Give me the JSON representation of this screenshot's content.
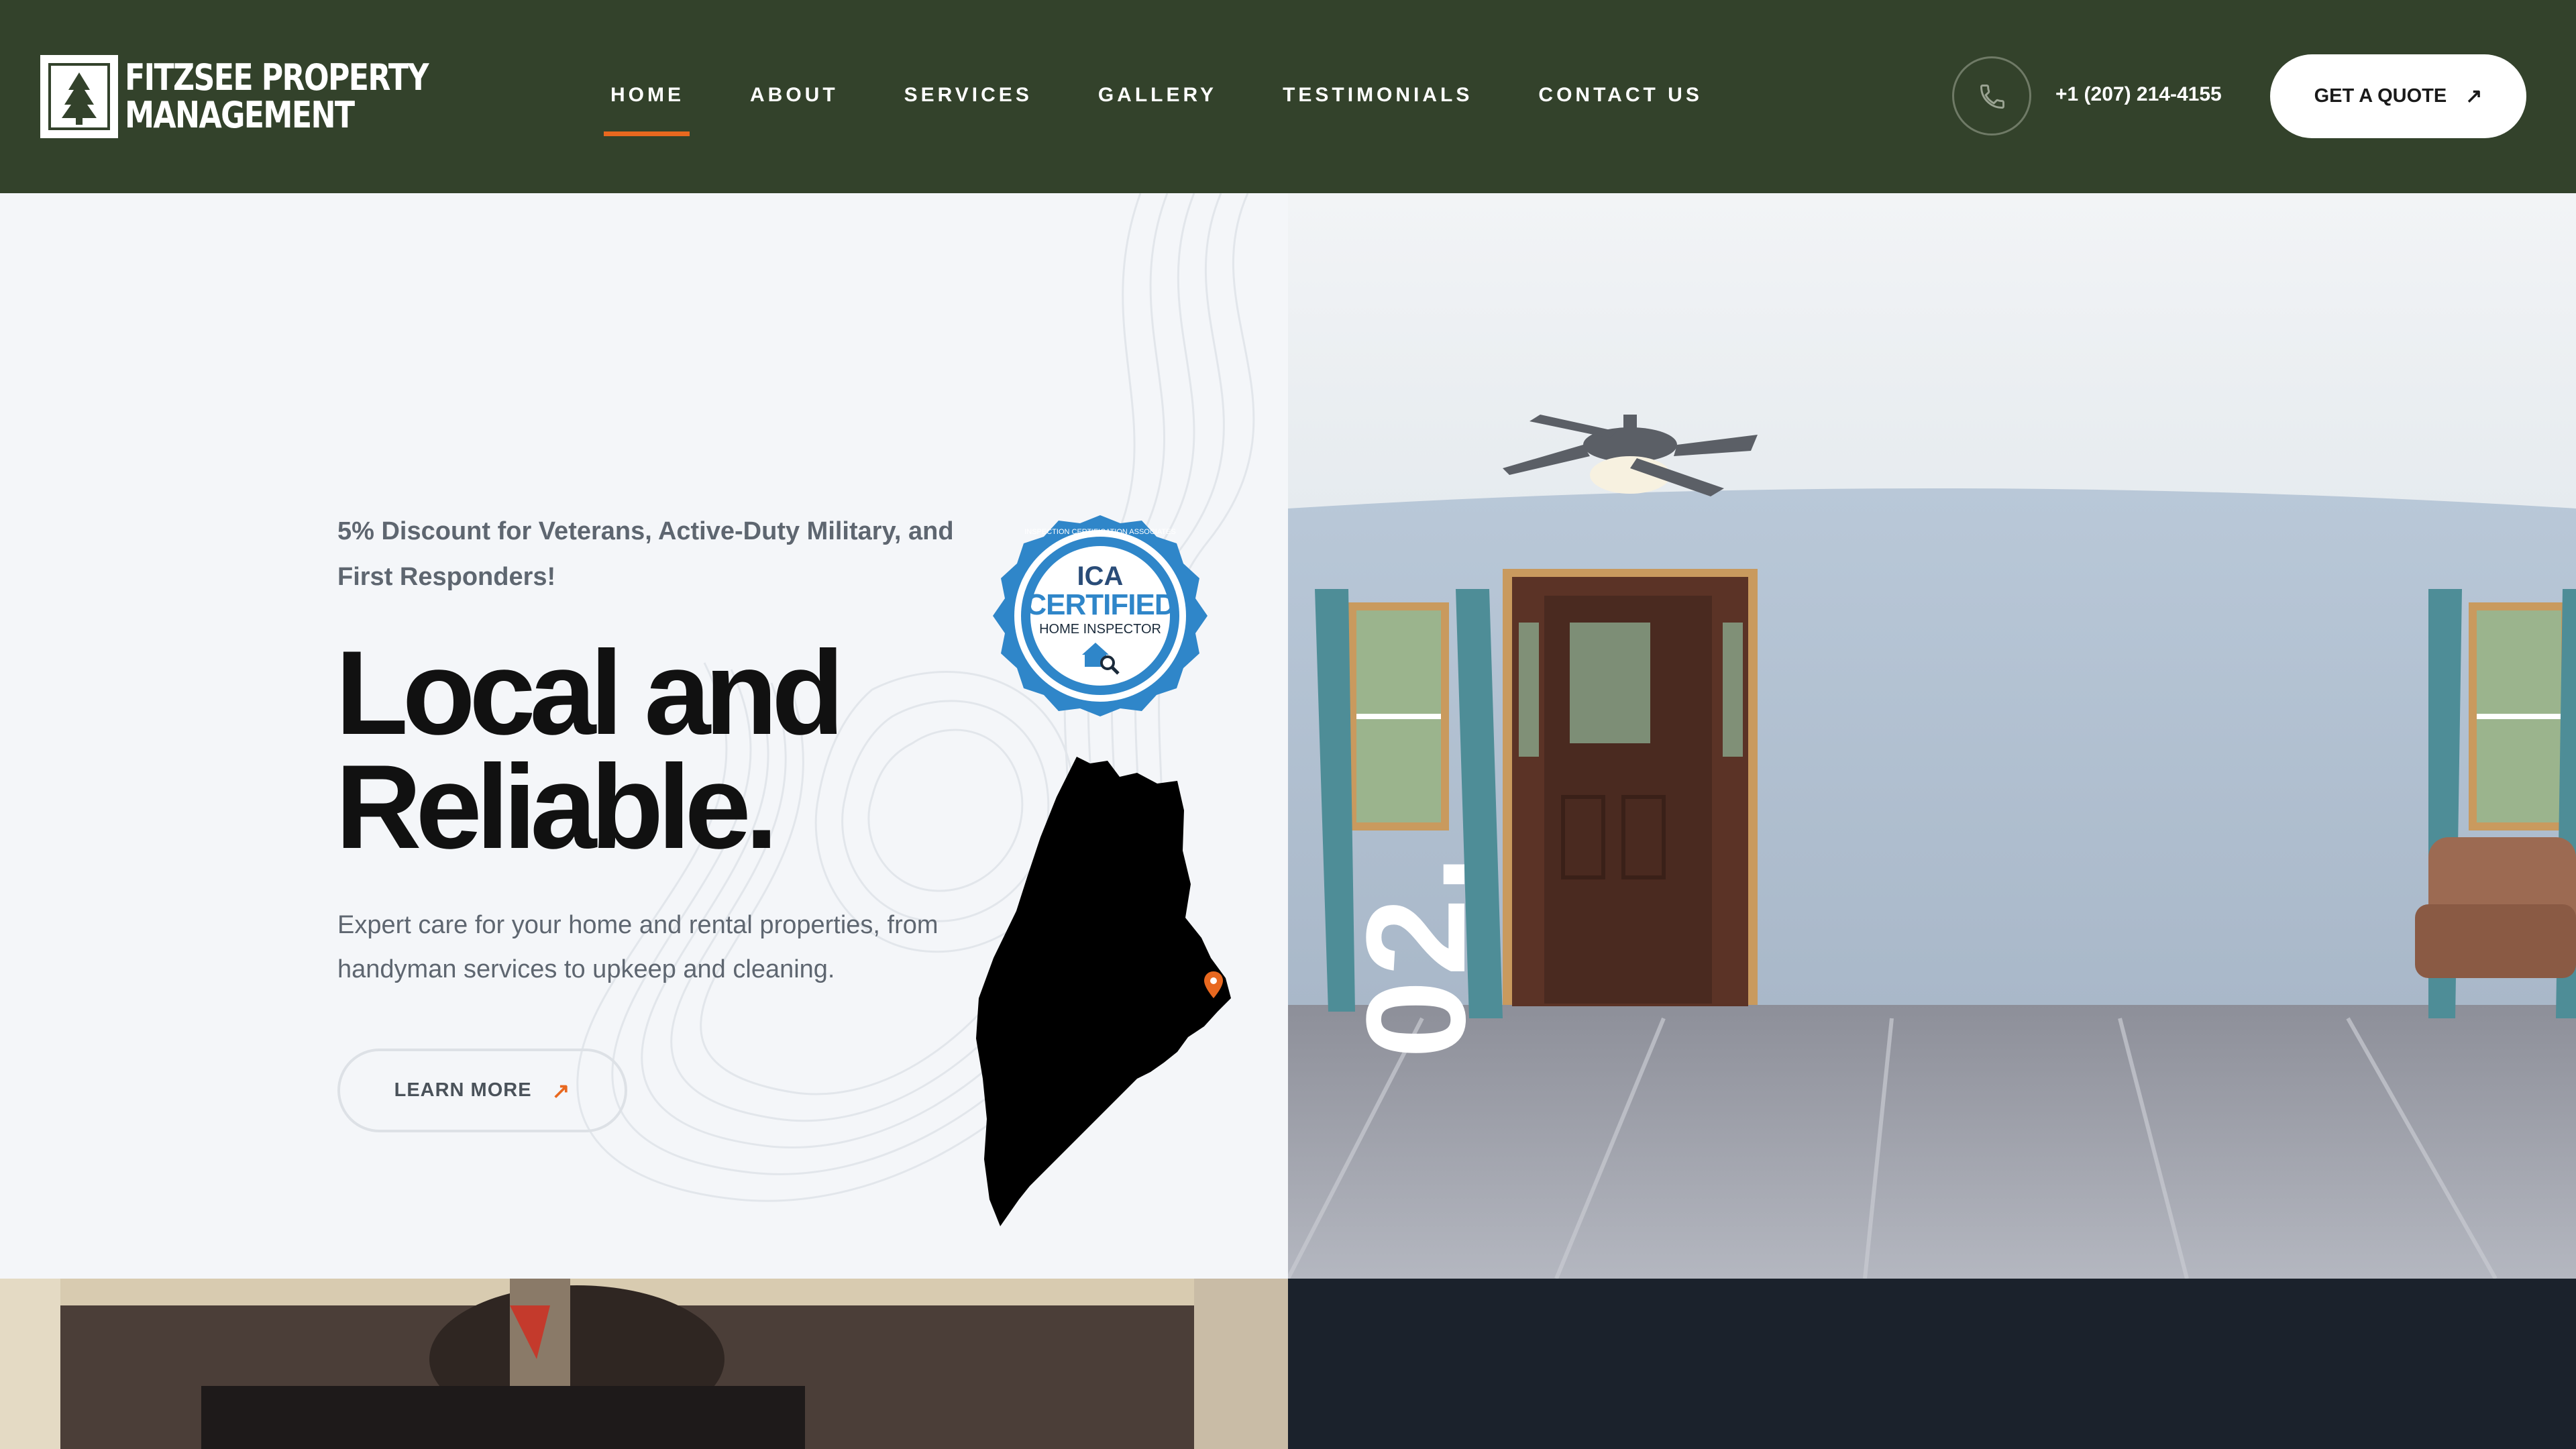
{
  "brand": {
    "line1": "FITZSEE PROPERTY",
    "line2": "MANAGEMENT"
  },
  "nav": {
    "items": [
      {
        "label": "HOME",
        "active": true
      },
      {
        "label": "ABOUT",
        "active": false
      },
      {
        "label": "SERVICES",
        "active": false
      },
      {
        "label": "GALLERY",
        "active": false
      },
      {
        "label": "TESTIMONIALS",
        "active": false
      },
      {
        "label": "CONTACT US",
        "active": false
      }
    ]
  },
  "contact": {
    "phone": "+1 (207) 214-4155",
    "phone_icon": "phone-icon"
  },
  "cta": {
    "quote_label": "GET A QUOTE",
    "learn_label": "LEARN MORE",
    "arrow": "↗"
  },
  "hero": {
    "discount": "5% Discount for Veterans, Active-Duty Military, and First Responders!",
    "headline_line1": "Local and",
    "headline_line2": "Reliable.",
    "subcopy": "Expert care for your home and rental properties, from handyman services to upkeep and cleaning.",
    "slide_number": "02."
  },
  "badge": {
    "brand": "ICA",
    "title": "CERTIFIED",
    "subtitle": "HOME INSPECTOR",
    "ring_text": "INSPECTION CERTIFICATION ASSOCIATES"
  },
  "colors": {
    "header_bg": "#33422b",
    "accent": "#e8681f",
    "hero_bg": "#f4f6f9",
    "footer_dark": "#1b222c",
    "badge_blue": "#2f86c9"
  }
}
